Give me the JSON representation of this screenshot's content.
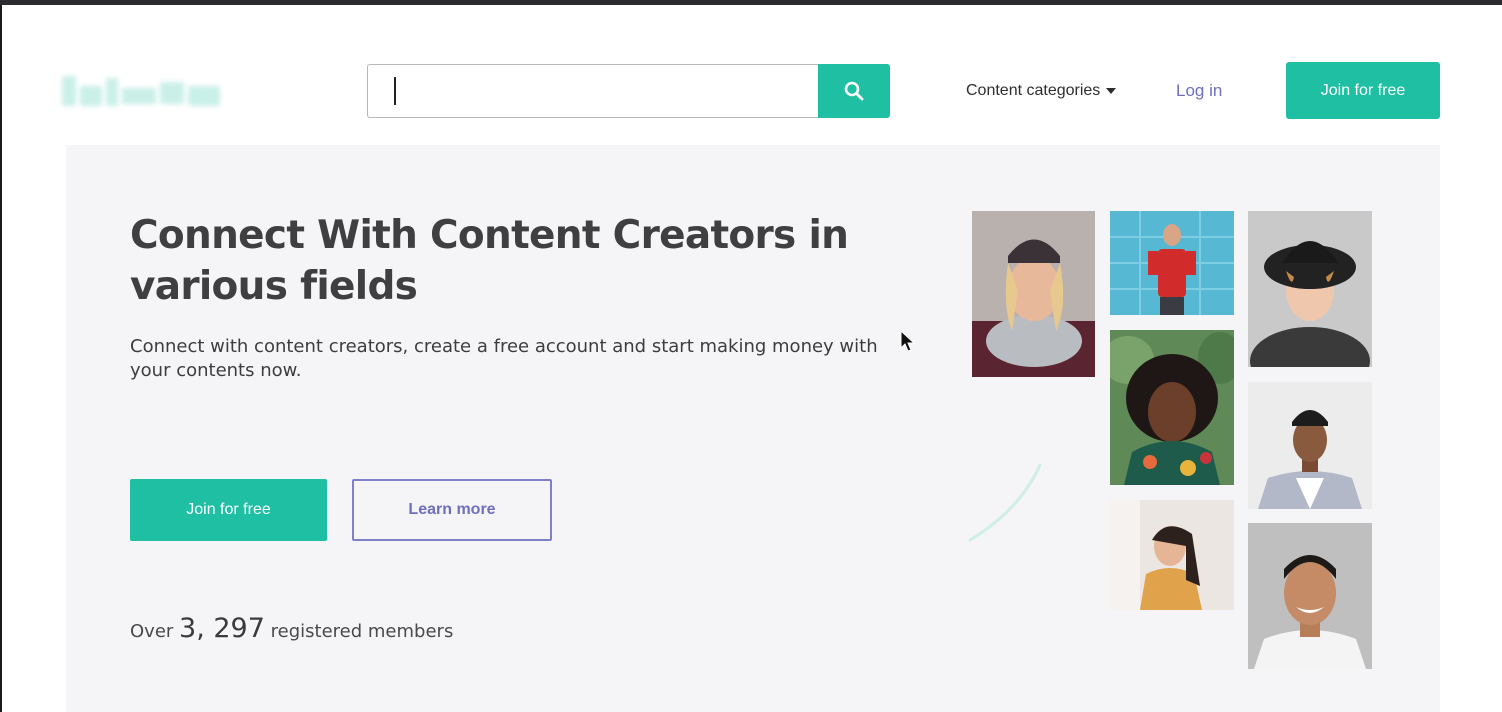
{
  "colors": {
    "accent": "#1ebfa3",
    "link": "#6f6fbd",
    "hero_bg": "#f5f4f7",
    "heading": "#3f3f41"
  },
  "header": {
    "search": {
      "value": "",
      "placeholder": "",
      "button_icon": "search-icon"
    },
    "nav": {
      "content_categories": "Content categories",
      "dropdown_icon": "caret-down-icon",
      "login": "Log in",
      "join": "Join for free"
    }
  },
  "hero": {
    "title": "Connect With Content Creators in various fields",
    "subtitle": "Connect with content creators, create a free account and start making money with your contents now.",
    "primary_cta": "Join for free",
    "secondary_cta": "Learn more",
    "members": {
      "prefix": "Over",
      "count": "3, 297",
      "suffix": "registered members"
    }
  }
}
